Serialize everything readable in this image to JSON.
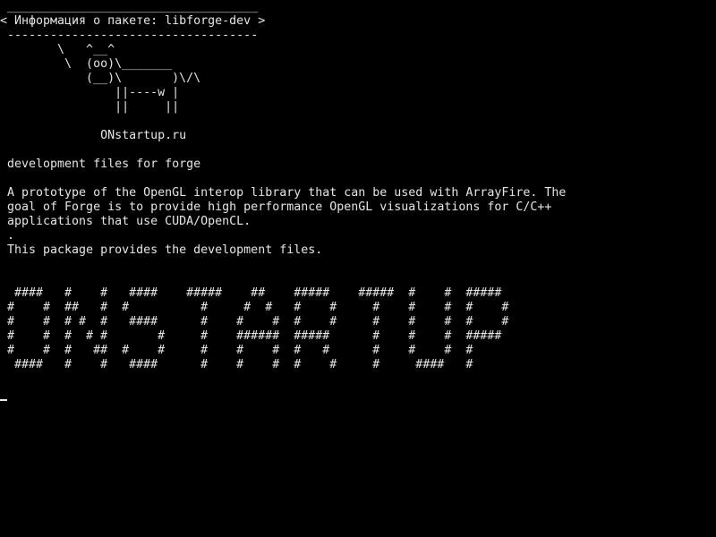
{
  "header": {
    "top_rule": " ___________________________________",
    "title_line": "< Информация о пакете: libforge-dev >",
    "bottom_rule": " -----------------------------------"
  },
  "cow_art": "       \\   ^__^\n        \\  (oo)\\_______\n           (__)\\       )\\/\\\n               ||----w |\n               ||     ||\n\n             ONstartup.ru",
  "description": {
    "summary": "development files for forge",
    "body": "A prototype of the OpenGL interop library that can be used with ArrayFire. The\ngoal of Forge is to provide high performance OpenGL visualizations for C/C++\napplications that use CUDA/OpenCL.\n.\nThis package provides the development files."
  },
  "banner_art": " ####   #    #   ####    #####    ##    #####    #####  #    #  #####\n#    #  ##   #  #          #     #  #   #    #     #    #    #  #    #\n#    #  # #  #   ####      #    #    #  #    #     #    #    #  #    #\n#    #  #  # #       #     #    ######  #####      #    #    #  #####\n#    #  #   ##  #    #     #    #    #  #   #      #    #    #  #\n ####   #    #   ####      #    #    #  #    #     #     ####   #",
  "colors": {
    "background": "#000000",
    "foreground": "#e6e6e6"
  }
}
